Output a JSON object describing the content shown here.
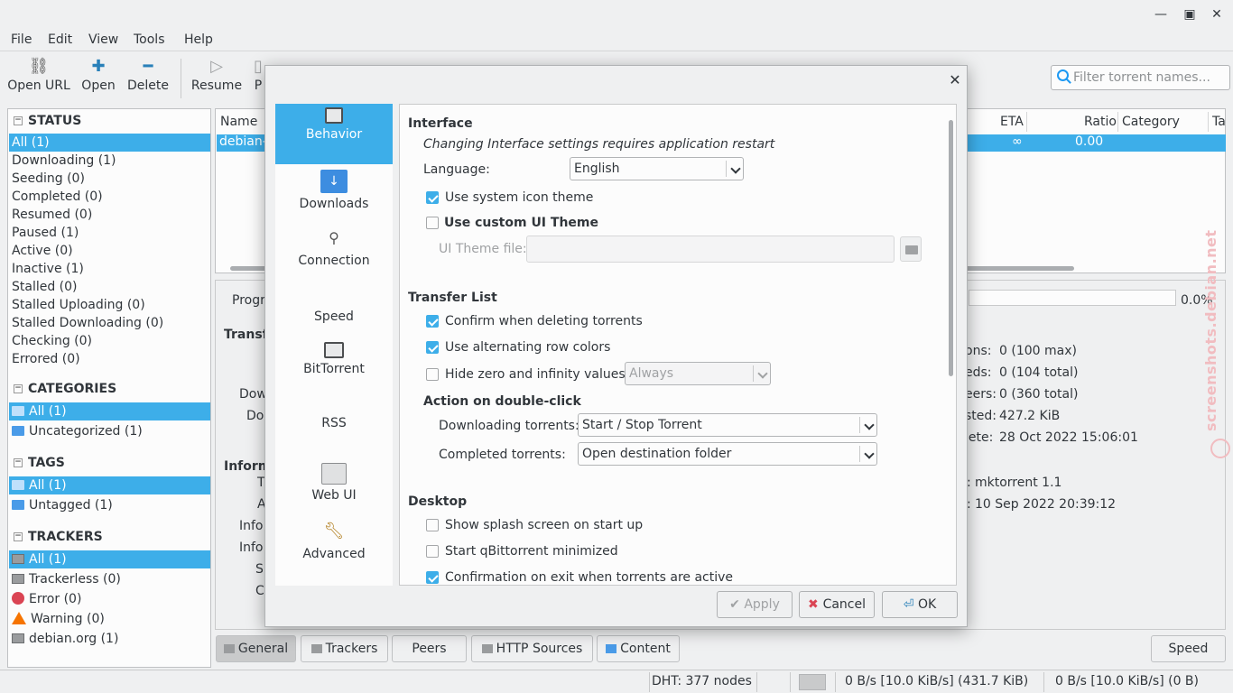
{
  "window": {
    "minimize": "—",
    "maximize": "▣",
    "close": "✕"
  },
  "menu": [
    "File",
    "Edit",
    "View",
    "Tools",
    "Help"
  ],
  "toolbar": {
    "open_url": "Open URL",
    "open": "Open",
    "delete": "Delete",
    "resume": "Resume",
    "pause_partial": "P"
  },
  "search": {
    "placeholder": "Filter torrent names..."
  },
  "sidebar": {
    "status_title": "STATUS",
    "status": [
      "All (1)",
      "Downloading (1)",
      "Seeding (0)",
      "Completed (0)",
      "Resumed (0)",
      "Paused (1)",
      "Active (0)",
      "Inactive (1)",
      "Stalled (0)",
      "Stalled Uploading (0)",
      "Stalled Downloading (0)",
      "Checking (0)",
      "Errored (0)"
    ],
    "categories_title": "CATEGORIES",
    "categories": [
      "All (1)",
      "Uncategorized (1)"
    ],
    "tags_title": "TAGS",
    "tags": [
      "All (1)",
      "Untagged (1)"
    ],
    "trackers_title": "TRACKERS",
    "trackers": [
      "All (1)",
      "Trackerless (0)",
      "Error (0)",
      "Warning (0)",
      "debian.org (1)"
    ]
  },
  "list": {
    "col_name": "Name",
    "col_eta": "ETA",
    "col_ratio": "Ratio",
    "col_category": "Category",
    "col_tags": "Ta",
    "row_name": "debian-",
    "row_eta": "∞",
    "row_ratio": "0.00"
  },
  "props": {
    "progress_partial": "Progr",
    "progress_value": "0.0%",
    "transfer_partial": "Transf",
    "down1": "Dow",
    "down2": "Do",
    "info_partial": "Inform",
    "t": "T",
    "a": "A",
    "info1": "Info",
    "info2": "Info",
    "s": "S",
    "c": "C",
    "connections": "ons:",
    "connections_val": "0 (100 max)",
    "seeds": "eds:",
    "seeds_val": "0 (104 total)",
    "peers": "eers:",
    "peers_val": "0 (360 total)",
    "wasted": "sted:",
    "wasted_val": "427.2 KiB",
    "complete": "lete:",
    "complete_val": "28 Oct 2022 15:06:01",
    "created_by": ":",
    "created_by_val": "mktorrent 1.1",
    "created_on": ":",
    "created_on_val": "10 Sep 2022 20:39:12"
  },
  "tabs": {
    "general": "General",
    "trackers": "Trackers",
    "peers": "Peers",
    "http": "HTTP Sources",
    "content": "Content",
    "speed": "Speed"
  },
  "status": {
    "dht": "DHT: 377 nodes",
    "down": "0 B/s [10.0 KiB/s] (431.7 KiB)",
    "up": "0 B/s [10.0 KiB/s] (0 B)"
  },
  "watermark": "screenshots.debian.net",
  "dialog": {
    "close": "✕",
    "categories": [
      "Behavior",
      "Downloads",
      "Connection",
      "Speed",
      "BitTorrent",
      "RSS",
      "Web UI",
      "Advanced"
    ],
    "interface_title": "Interface",
    "interface_note": "Changing Interface settings requires application restart",
    "language_label": "Language:",
    "language_value": "English",
    "use_system_icons": "Use system icon theme",
    "use_custom_theme": "Use custom UI Theme",
    "theme_file_label": "UI Theme file:",
    "transfer_title": "Transfer List",
    "confirm_delete": "Confirm when deleting torrents",
    "alt_rows": "Use alternating row colors",
    "hide_zero": "Hide zero and infinity values",
    "hide_zero_value": "Always",
    "double_click_title": "Action on double-click",
    "downloading_label": "Downloading torrents:",
    "downloading_value": "Start / Stop Torrent",
    "completed_label": "Completed torrents:",
    "completed_value": "Open destination folder",
    "desktop_title": "Desktop",
    "splash": "Show splash screen on start up",
    "start_min": "Start qBittorrent minimized",
    "confirm_exit": "Confirmation on exit when torrents are active",
    "apply": "Apply",
    "cancel": "Cancel",
    "ok": "OK"
  },
  "colors": {
    "accent": "#3daee9",
    "bg": "#eff0f1"
  }
}
